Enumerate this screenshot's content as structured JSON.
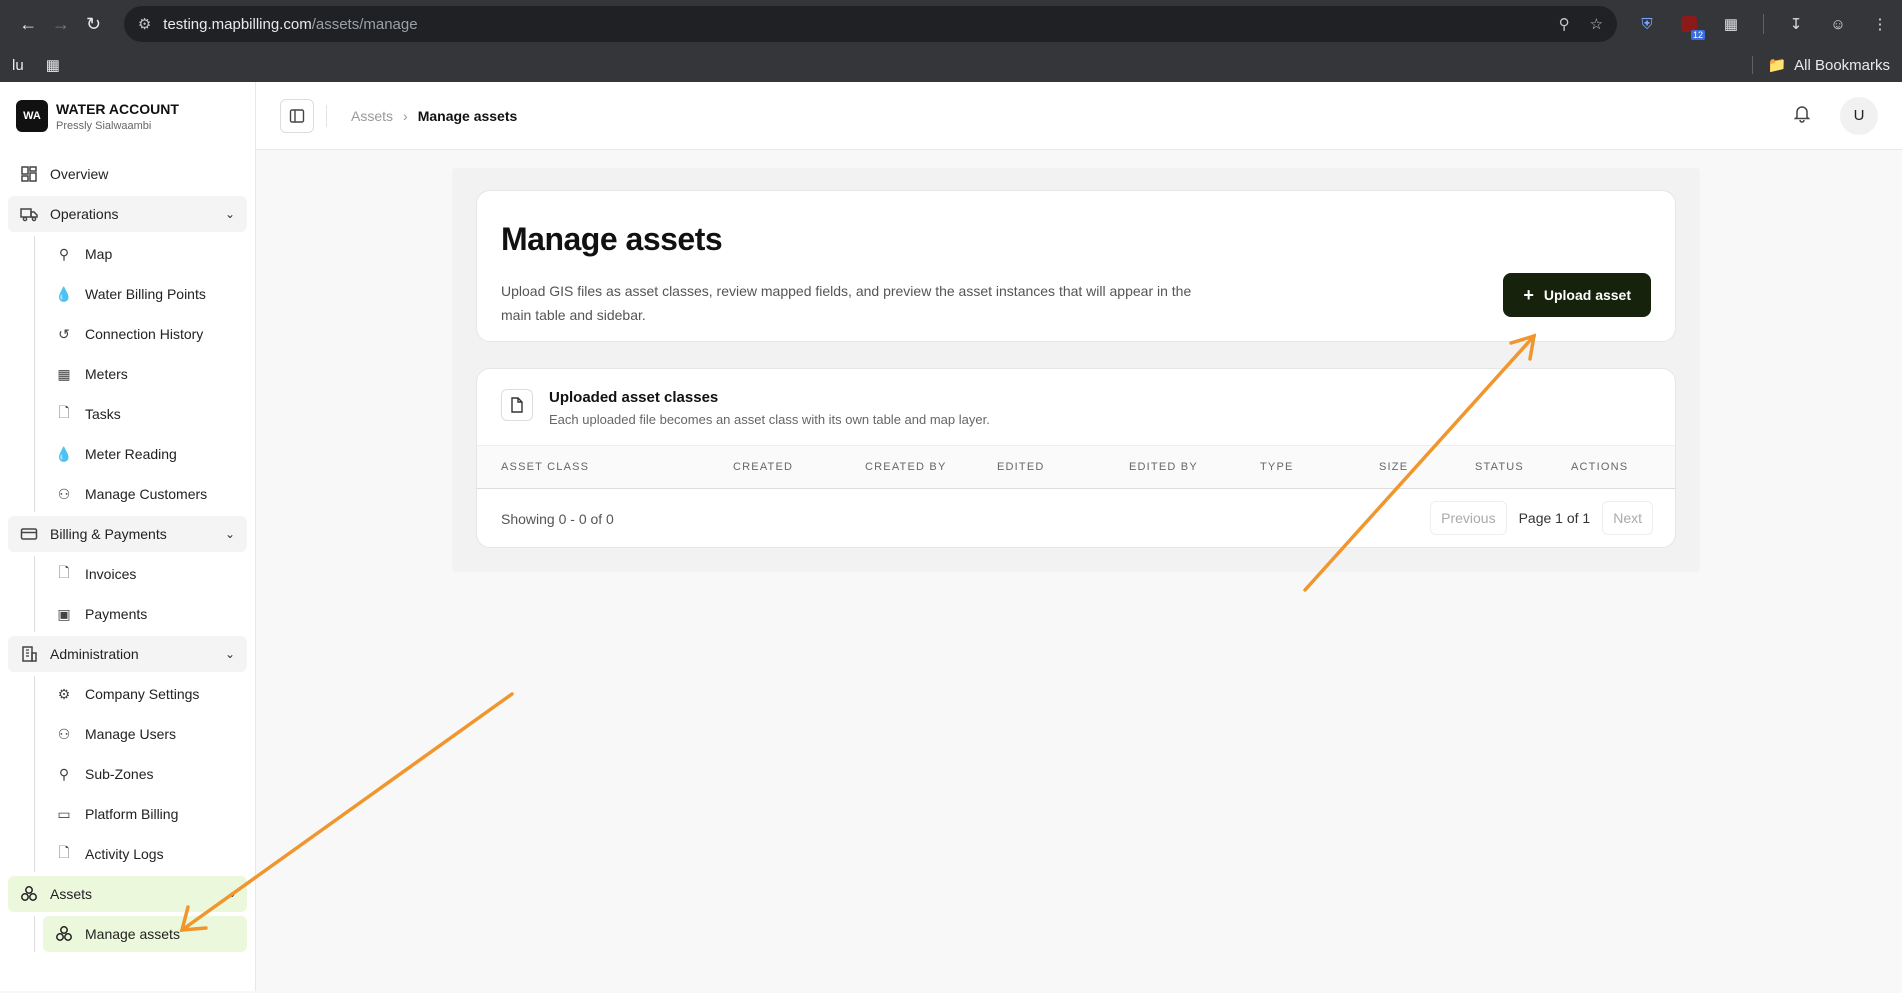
{
  "browser": {
    "url_host": "testing.mapbilling.com",
    "url_path": "/assets/manage",
    "bookmark_left_1": "lu",
    "all_bookmarks": "All Bookmarks",
    "ext_badge": "12"
  },
  "brand": {
    "logo": "WA",
    "name": "WATER ACCOUNT",
    "user": "Pressly Sialwaambi"
  },
  "sidebar": {
    "overview": "Overview",
    "operations": "Operations",
    "operations_items": [
      "Map",
      "Water Billing Points",
      "Connection History",
      "Meters",
      "Tasks",
      "Meter Reading",
      "Manage Customers"
    ],
    "billing": "Billing & Payments",
    "billing_items": [
      "Invoices",
      "Payments"
    ],
    "administration": "Administration",
    "administration_items": [
      "Company Settings",
      "Manage Users",
      "Sub-Zones",
      "Platform Billing",
      "Activity Logs"
    ],
    "assets": "Assets",
    "assets_items": [
      "Manage assets"
    ]
  },
  "topbar": {
    "crumb_parent": "Assets",
    "crumb_current": "Manage assets",
    "avatar": "U"
  },
  "header": {
    "title": "Manage assets",
    "description": "Upload GIS files as asset classes, review mapped fields, and preview the asset instances that will appear in the main table and sidebar.",
    "upload_label": "Upload asset"
  },
  "table": {
    "title": "Uploaded asset classes",
    "subtitle": "Each uploaded file becomes an asset class with its own table and map layer.",
    "columns": [
      "ASSET CLASS",
      "CREATED",
      "CREATED BY",
      "EDITED",
      "EDITED BY",
      "TYPE",
      "SIZE",
      "STATUS",
      "ACTIONS"
    ],
    "showing": "Showing 0 - 0 of 0",
    "previous": "Previous",
    "page_info": "Page 1 of 1",
    "next": "Next"
  },
  "colors": {
    "accent_dark": "#16220b",
    "active_bg": "#ecf8dc",
    "arrow": "#f0962e"
  }
}
